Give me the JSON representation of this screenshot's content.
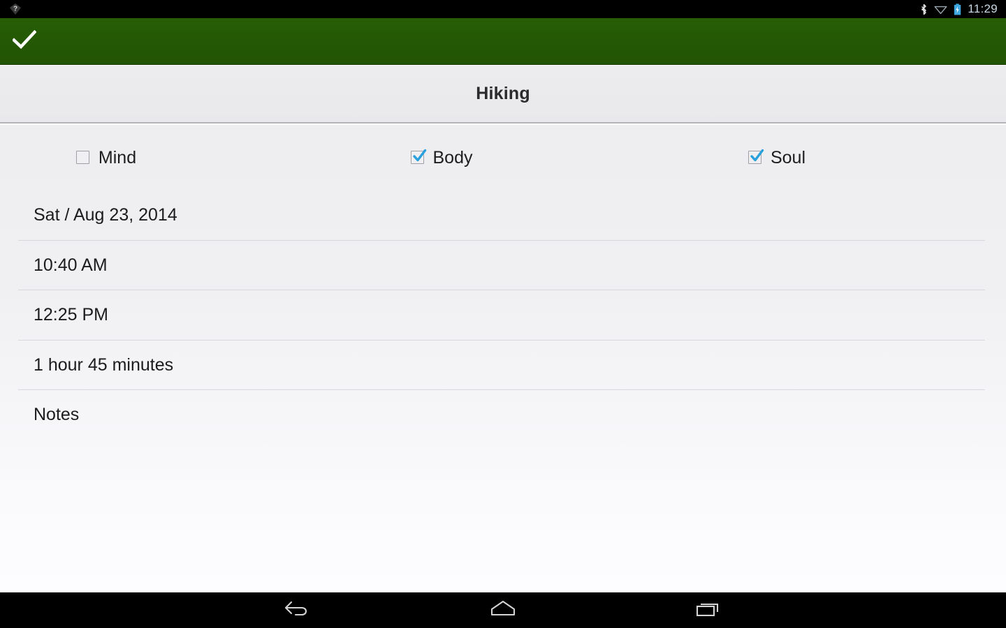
{
  "status_bar": {
    "notification_icon": "question-mark-notification-icon",
    "icons": [
      "bluetooth-icon",
      "wifi-icon",
      "battery-charging-icon"
    ],
    "time": "11:29"
  },
  "action_bar": {
    "color": "#245904",
    "done_icon": "checkmark-icon",
    "done_label": "Done"
  },
  "title_bar": {
    "title": "Hiking"
  },
  "categories": [
    {
      "label": "Mind",
      "checked": false
    },
    {
      "label": "Body",
      "checked": true
    },
    {
      "label": "Soul",
      "checked": true
    }
  ],
  "details": [
    {
      "name": "date",
      "value": "Sat / Aug 23, 2014"
    },
    {
      "name": "start-time",
      "value": "10:40 AM"
    },
    {
      "name": "end-time",
      "value": "12:25 PM"
    },
    {
      "name": "duration",
      "value": "1 hour 45 minutes"
    },
    {
      "name": "notes",
      "value": "Notes"
    }
  ],
  "nav_bar": {
    "back": "back-icon",
    "home": "home-icon",
    "recents": "recents-icon"
  },
  "colors": {
    "accent_green": "#245904",
    "checkbox_blue": "#27a0db",
    "divider": "#d8d8dc",
    "text": "#1c1c1c"
  }
}
